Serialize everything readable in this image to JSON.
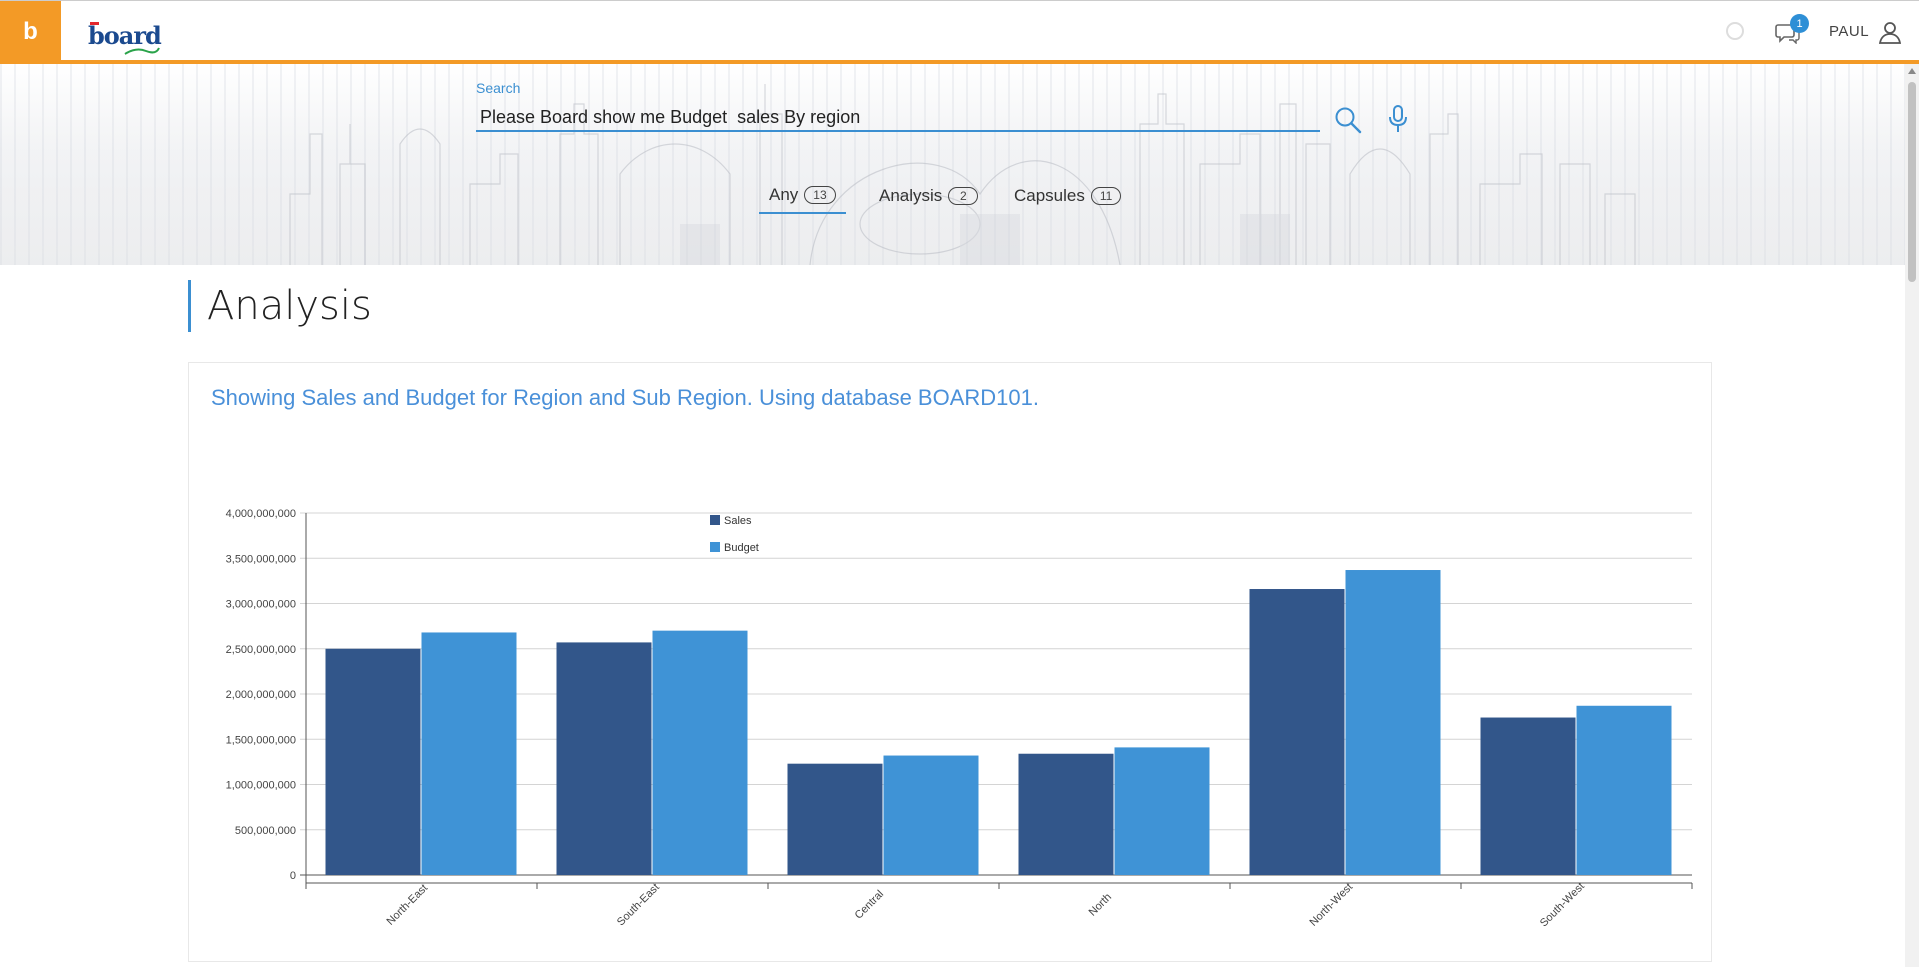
{
  "header": {
    "brand_glyph": "b",
    "logo_text": "board",
    "notification_count": "1",
    "username": "PAUL"
  },
  "search": {
    "label": "Search",
    "value": "Please Board show me Budget  sales By region"
  },
  "tabs": [
    {
      "label": "Any",
      "count": "13",
      "active": true
    },
    {
      "label": "Analysis",
      "count": "2",
      "active": false
    },
    {
      "label": "Capsules",
      "count": "11",
      "active": false
    }
  ],
  "section": {
    "title": "Analysis",
    "card_title": "Showing Sales and Budget for Region and Sub Region. Using database BOARD101."
  },
  "colors": {
    "accent": "#f39a26",
    "link_blue": "#3b8fd1",
    "sales": "#32568a",
    "budget": "#3f93d6"
  },
  "chart_data": {
    "type": "bar",
    "categories": [
      "North-East",
      "South-East",
      "Central",
      "North",
      "North-West",
      "South-West"
    ],
    "series": [
      {
        "name": "Sales",
        "values": [
          2500000000,
          2570000000,
          1230000000,
          1340000000,
          3160000000,
          1740000000
        ]
      },
      {
        "name": "Budget",
        "values": [
          2680000000,
          2700000000,
          1320000000,
          1410000000,
          3370000000,
          1870000000
        ]
      }
    ],
    "ylim": [
      0,
      4000000000
    ],
    "yticks": [
      "0",
      "500,000,000",
      "1,000,000,000",
      "1,500,000,000",
      "2,000,000,000",
      "2,500,000,000",
      "3,000,000,000",
      "3,500,000,000",
      "4,000,000,000"
    ],
    "grid": true,
    "legend": "top-left"
  }
}
